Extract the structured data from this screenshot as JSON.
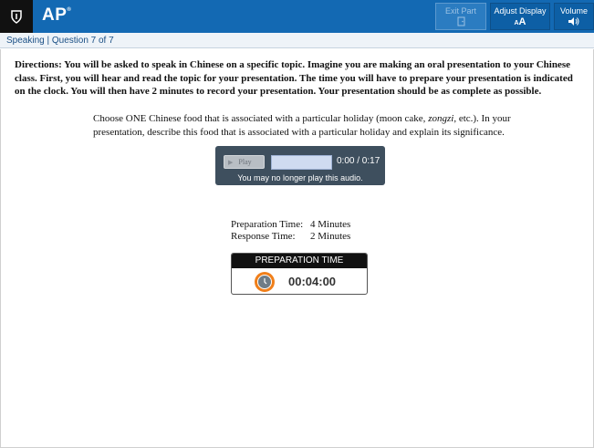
{
  "header": {
    "brand": "AP",
    "buttons": {
      "exit_part": "Exit Part",
      "adjust_display": "Adjust Display",
      "adjust_display_icon_text": "AA",
      "volume": "Volume"
    }
  },
  "breadcrumb": "Speaking | Question 7 of 7",
  "directions": "Directions: You will be asked to speak in Chinese on a specific topic. Imagine you are making an oral presentation to your Chinese class. First, you will hear and read the topic for your presentation. The time you will have to prepare your presentation is indicated on the clock. You will then have 2 minutes to record your presentation. Your presentation should be as complete as possible.",
  "prompt": {
    "before": "Choose ONE Chinese food that is associated with a particular holiday (moon cake, ",
    "italic": "zongzi",
    "after": ", etc.).  In your presentation, describe this food that is associated with a particular holiday and explain its significance."
  },
  "audio": {
    "play_label": "Play",
    "time_display": "0:00 / 0:17",
    "notice": "You may no longer play this audio.",
    "progress": 0
  },
  "times": {
    "prep_label": "Preparation Time:",
    "prep_value": "4 Minutes",
    "resp_label": "Response Time:",
    "resp_value": "2 Minutes"
  },
  "prep_timer": {
    "title": "PREPARATION TIME",
    "time": "00:04:00"
  },
  "colors": {
    "topbar": "#1369b3",
    "timer_accent": "#f07f1a"
  }
}
